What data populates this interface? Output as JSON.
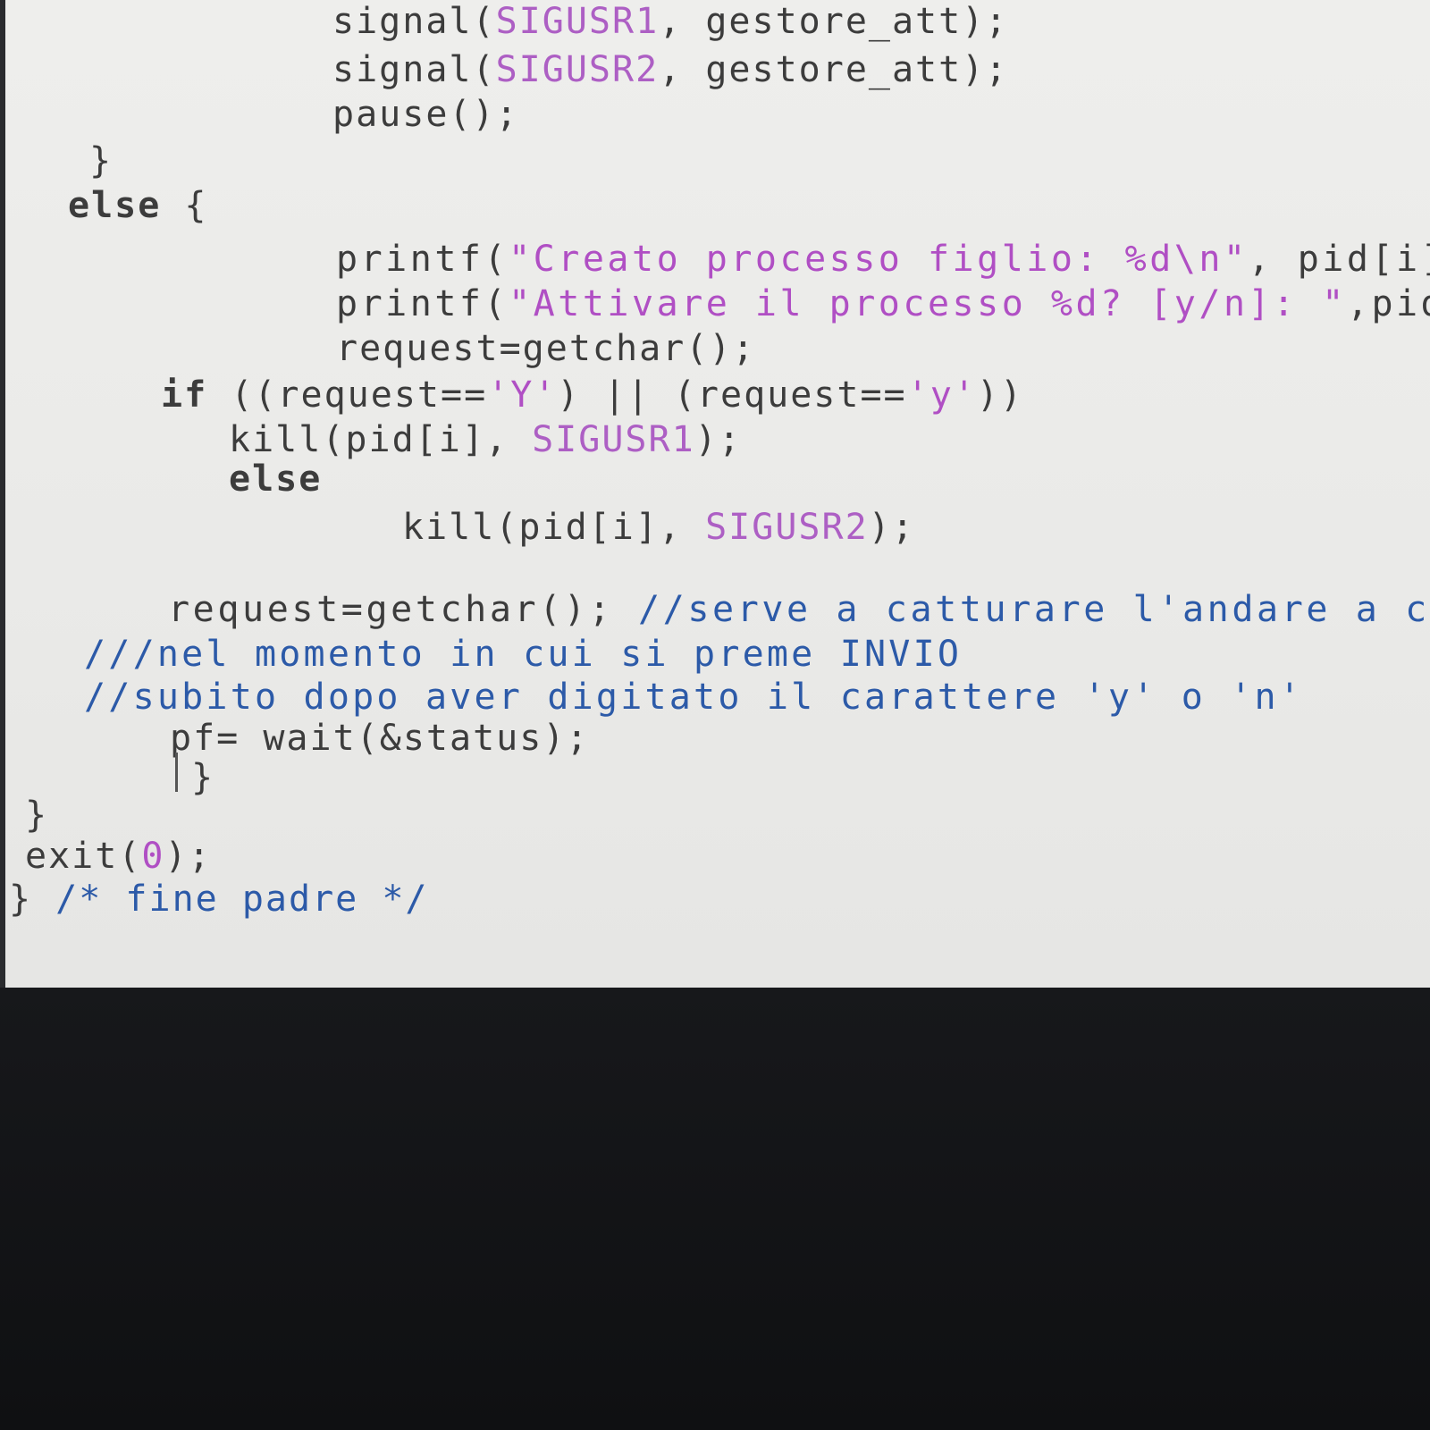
{
  "editor": {
    "lines": [
      {
        "parts": [
          {
            "t": "signal(",
            "c": "plain"
          },
          {
            "t": "SIGUSR1",
            "c": "mac"
          },
          {
            "t": ", gestore_att);",
            "c": "plain"
          }
        ]
      },
      {
        "parts": [
          {
            "t": "signal(",
            "c": "plain"
          },
          {
            "t": "SIGUSR2",
            "c": "mac"
          },
          {
            "t": ", gestore_att);",
            "c": "plain"
          }
        ]
      },
      {
        "parts": [
          {
            "t": "pause();",
            "c": "plain"
          }
        ]
      },
      {
        "parts": [
          {
            "t": "}",
            "c": "plain"
          }
        ]
      },
      {
        "parts": [
          {
            "t": "else",
            "c": "kw"
          },
          {
            "t": " {",
            "c": "plain"
          }
        ]
      },
      {
        "parts": [
          {
            "t": "printf(",
            "c": "plain"
          },
          {
            "t": "\"Creato processo figlio: %d\\n\"",
            "c": "str"
          },
          {
            "t": ", pid[i]);",
            "c": "plain"
          }
        ]
      },
      {
        "parts": [
          {
            "t": "printf(",
            "c": "plain"
          },
          {
            "t": "\"Attivare il processo %d? [y/n]: \"",
            "c": "str"
          },
          {
            "t": ",pid[i",
            "c": "plain"
          }
        ]
      },
      {
        "parts": [
          {
            "t": "request=getchar();",
            "c": "plain"
          }
        ]
      },
      {
        "parts": [
          {
            "t": "if",
            "c": "kw"
          },
          {
            "t": " ((request==",
            "c": "plain"
          },
          {
            "t": "'Y'",
            "c": "chr"
          },
          {
            "t": ") || (request==",
            "c": "plain"
          },
          {
            "t": "'y'",
            "c": "chr"
          },
          {
            "t": "))",
            "c": "plain"
          }
        ]
      },
      {
        "parts": [
          {
            "t": "kill(pid[i], ",
            "c": "plain"
          },
          {
            "t": "SIGUSR1",
            "c": "mac"
          },
          {
            "t": ");",
            "c": "plain"
          }
        ]
      },
      {
        "parts": [
          {
            "t": "else",
            "c": "kw"
          }
        ]
      },
      {
        "parts": [
          {
            "t": "kill(pid[i], ",
            "c": "plain"
          },
          {
            "t": "SIGUSR2",
            "c": "mac"
          },
          {
            "t": ");",
            "c": "plain"
          }
        ]
      },
      {
        "parts": [
          {
            "t": "request=getchar(); ",
            "c": "plain"
          },
          {
            "t": "//serve a catturare l'andare a capo",
            "c": "cm"
          }
        ]
      },
      {
        "parts": [
          {
            "t": "///nel momento in cui si preme INVIO",
            "c": "cm"
          }
        ]
      },
      {
        "parts": [
          {
            "t": "//subito dopo aver digitato il carattere 'y' o 'n'",
            "c": "cm"
          }
        ]
      },
      {
        "parts": [
          {
            "t": "pf= wait(&status);",
            "c": "plain"
          }
        ]
      },
      {
        "parts": [
          {
            "t": "}",
            "c": "plain"
          }
        ]
      },
      {
        "parts": [
          {
            "t": "}",
            "c": "plain"
          }
        ]
      },
      {
        "parts": [
          {
            "t": "exit(",
            "c": "plain"
          },
          {
            "t": "0",
            "c": "num"
          },
          {
            "t": ");",
            "c": "plain"
          }
        ]
      },
      {
        "parts": [
          {
            "t": "} ",
            "c": "plain"
          },
          {
            "t": "/* fine padre */",
            "c": "cm"
          }
        ]
      }
    ]
  }
}
